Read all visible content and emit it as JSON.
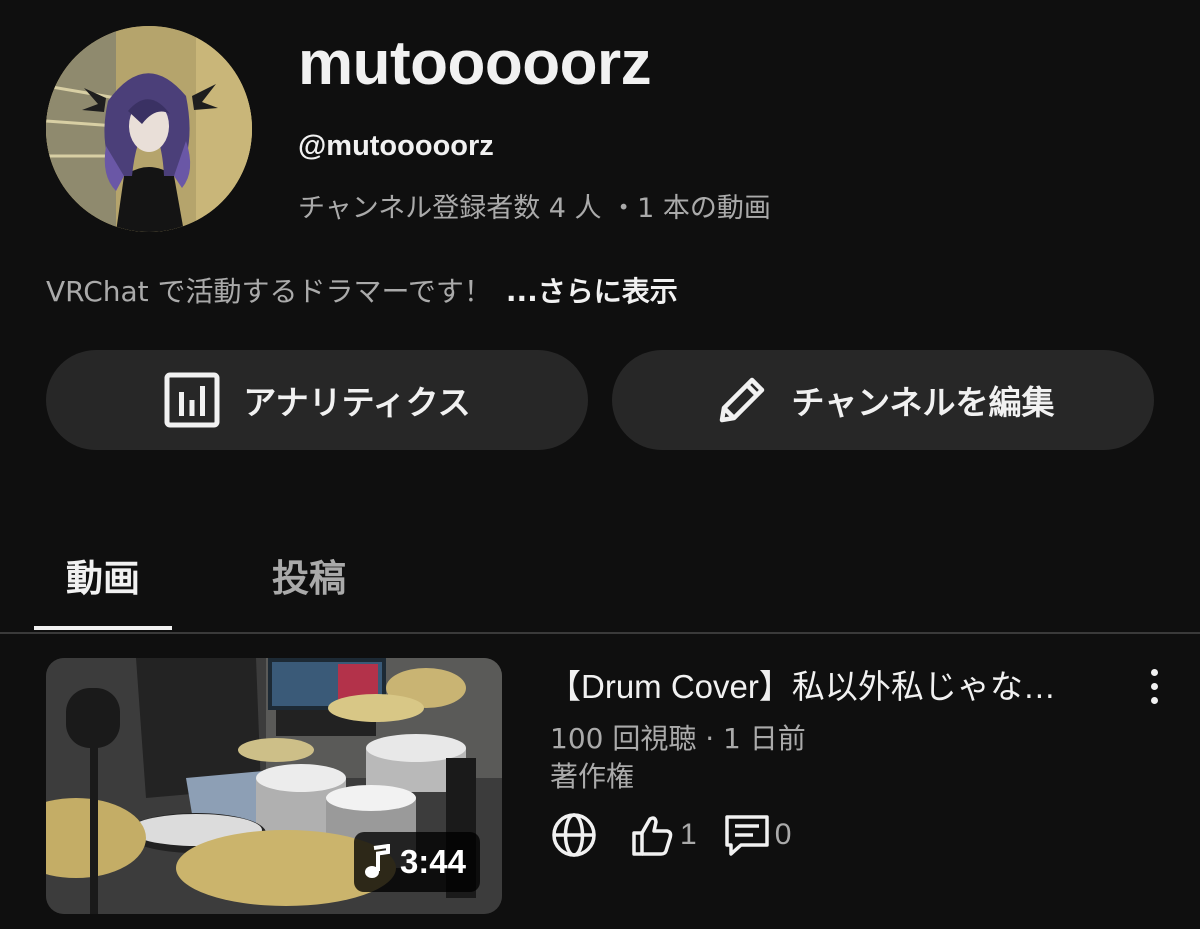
{
  "channel": {
    "name": "mutooooorz",
    "handle": "@mutooooorz",
    "stats": "チャンネル登録者数 4 人 ・1 本の動画",
    "description": "VRChat で活動するドラマーです！",
    "more_label": "...さらに表示"
  },
  "actions": {
    "analytics_label": "アナリティクス",
    "edit_label": "チャンネルを編集"
  },
  "tabs": [
    {
      "label": "動画",
      "selected": true
    },
    {
      "label": "投稿",
      "selected": false
    }
  ],
  "video": {
    "title": "【Drum Cover】私以外私じゃな…",
    "views_age": "100 回視聴 · 1 日前",
    "status": "著作権",
    "duration": "3:44",
    "likes": "1",
    "comments": "0",
    "visibility_icon": "globe-icon",
    "audio_icon": "music-note-icon"
  },
  "colors": {
    "background": "#0f0f0f",
    "text_primary": "#f1f1f1",
    "text_secondary": "#aaaaaa",
    "button_bg": "#272727"
  }
}
